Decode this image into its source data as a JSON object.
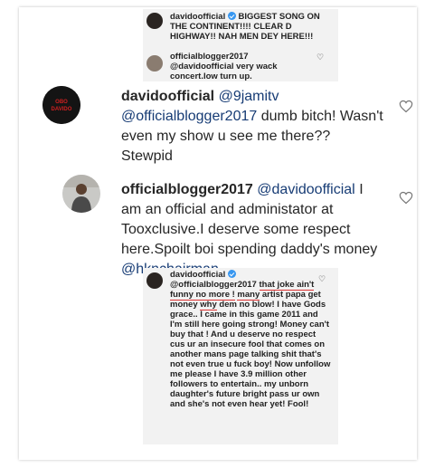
{
  "top_crop": {
    "comment1": {
      "username": "davidoofficial",
      "text": "BIGGEST SONG ON THE CONTINENT!!!! CLEAR D HIGHWAY!! NAH MEN DEY HERE!!!"
    },
    "comment2": {
      "username": "officialblogger2017",
      "mention": "@davidoofficial",
      "text": "very wack concert.low turn up."
    }
  },
  "comments": [
    {
      "username": "davidoofficial",
      "mention1": "@9jamitv",
      "mention2": "@officialblogger2017",
      "text": "dumb bitch! Wasn't even my show u see me there?? Stewpid",
      "avatar_text": "OBO DAVIDO"
    },
    {
      "username": "officialblogger2017",
      "mention1": "@davidoofficial",
      "text": "I am an official and administator at Tooxclusive.I deserve some respect here.Spoilt boi spending daddy's money",
      "mention2": "@hknchairman"
    }
  ],
  "bottom_crop": {
    "username": "davidoofficial",
    "mention": "@officialblogger2017",
    "text_a": "that joke ain't funny no more !",
    "text_b": "many",
    "text_c": "artist papa get money",
    "text_d": "why",
    "text_e": "dem no blow! I have Gods grace.. I came in this game 2011 and I'm still here going strong! Money can't buy that ! And u deserve no respect cus ur an insecure fool that comes on another mans page talking shit that's not even true u fuck boy! Now unfollow me please I have 3.9 million other followers to entertain.. my unborn daughter's future bright pass ur own and she's not even hear yet! Fool!"
  },
  "icons": {
    "like": "heart-icon",
    "verified": "verified-badge-icon"
  },
  "colors": {
    "mention": "#173c75",
    "verified": "#3897f0",
    "crop_bg": "#f2f2f2"
  }
}
